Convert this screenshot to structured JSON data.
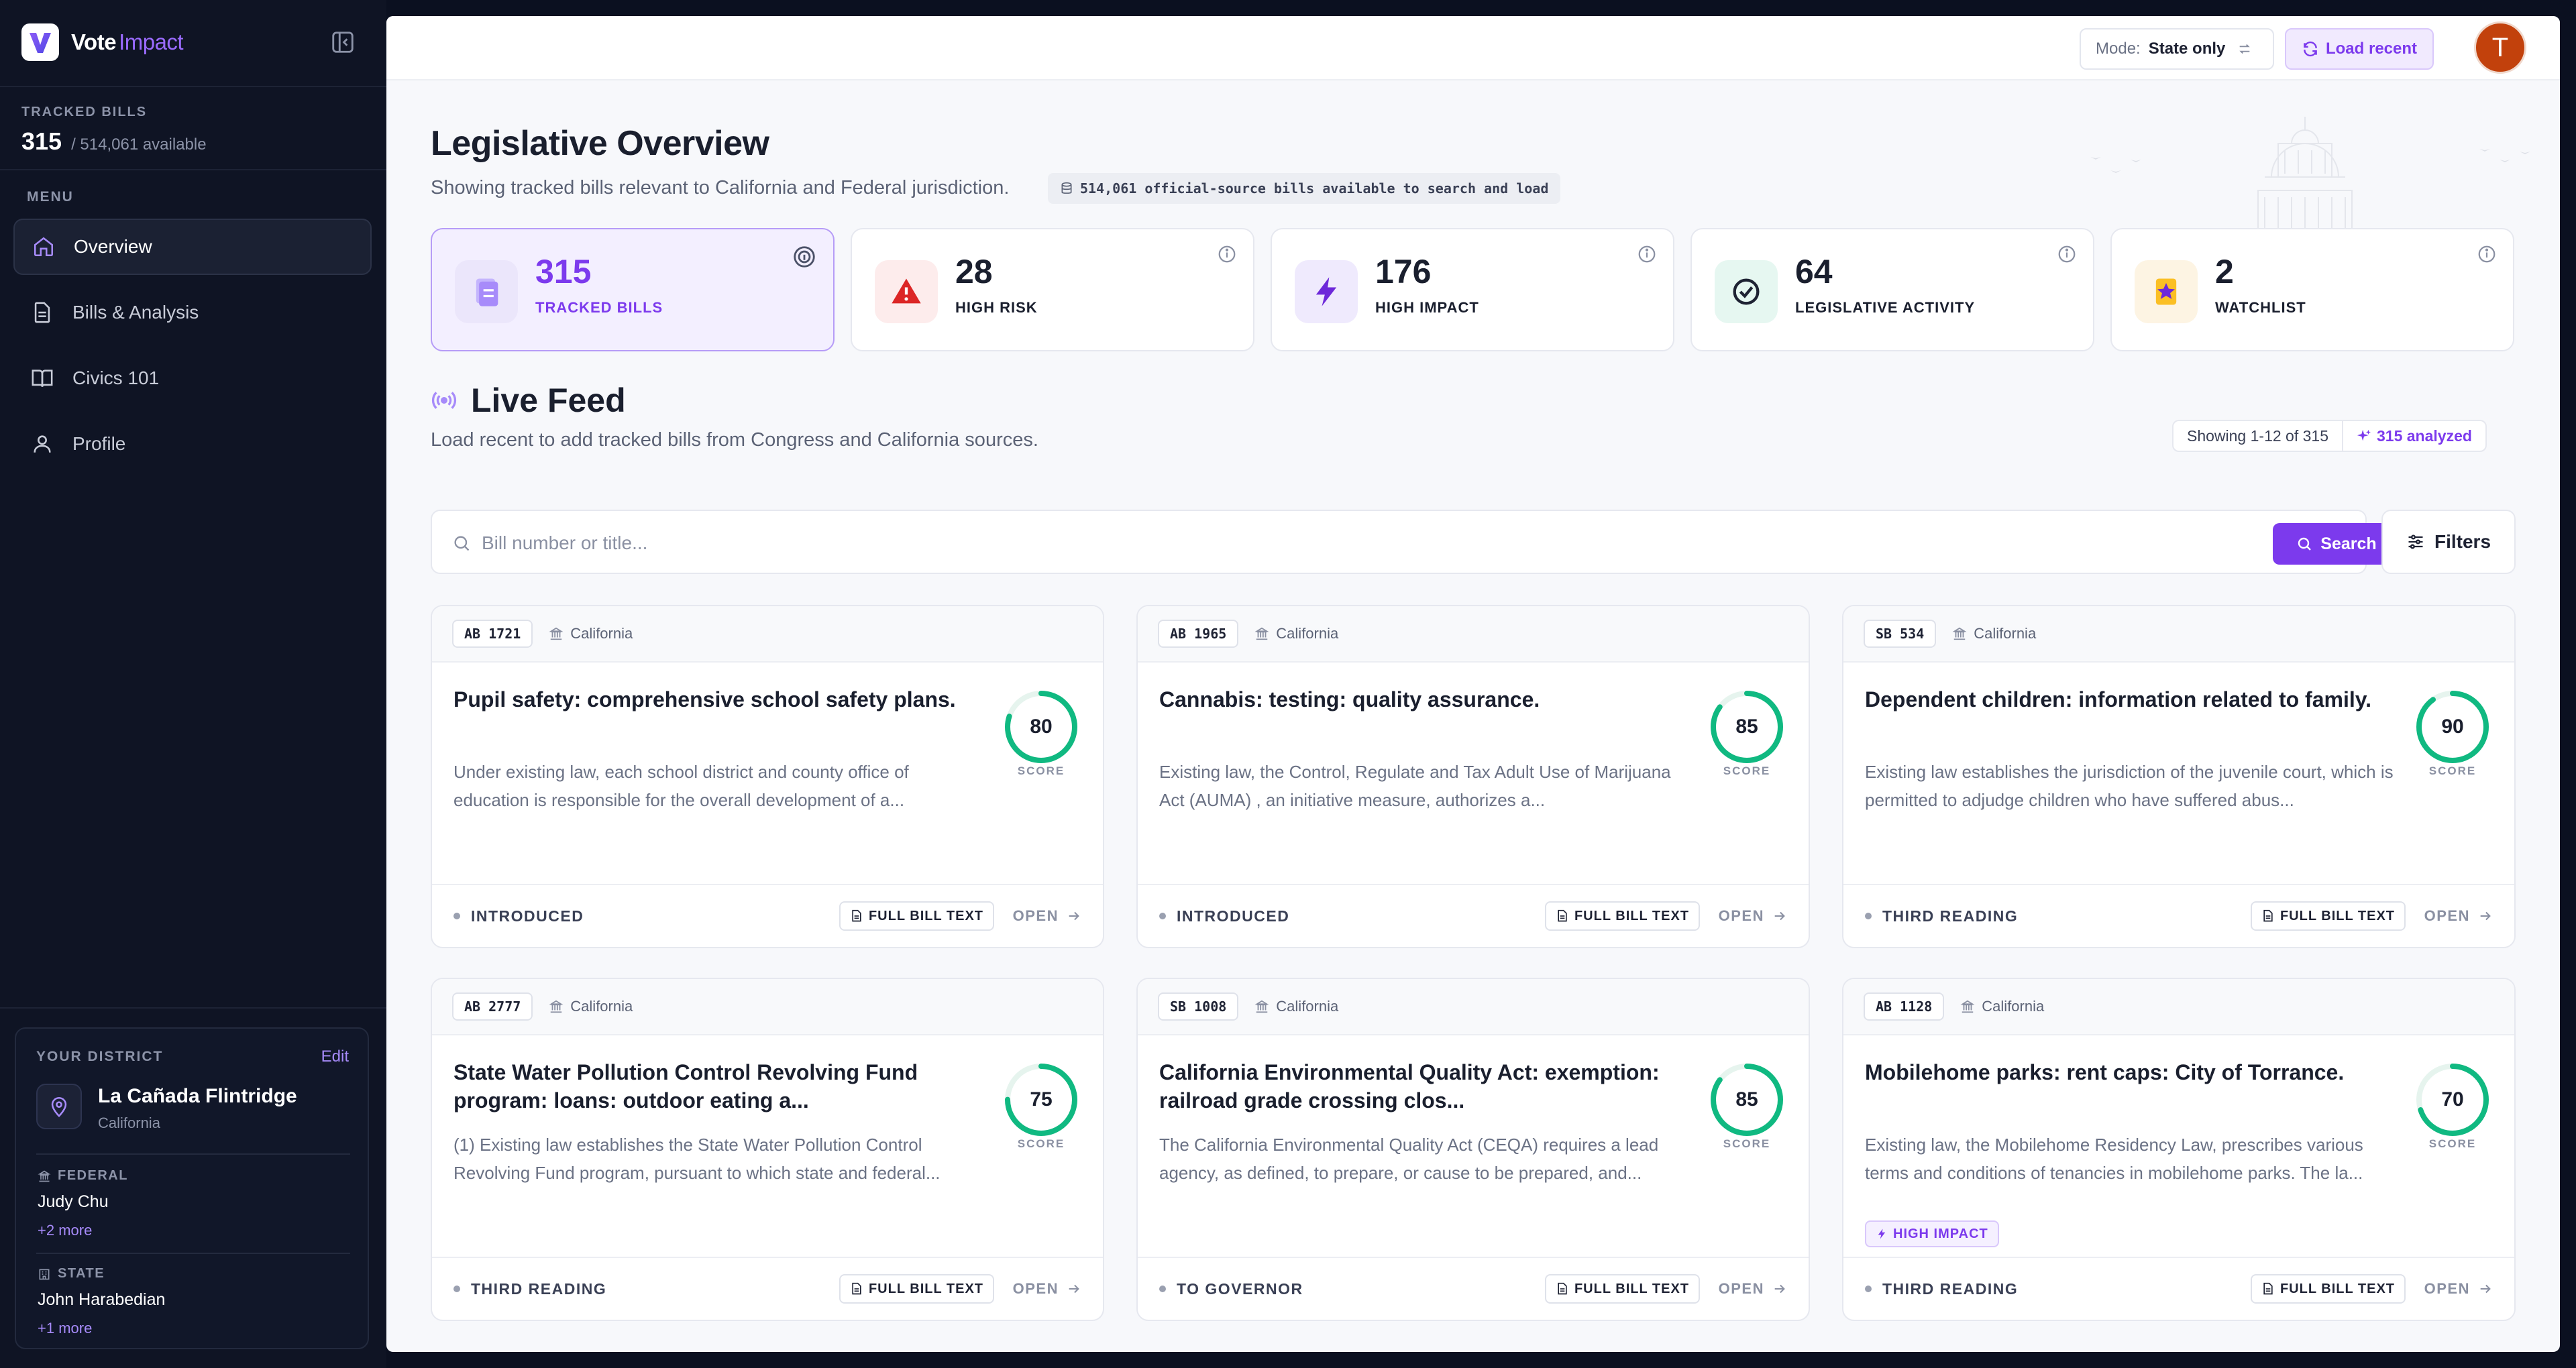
{
  "brand": {
    "name_a": "Vote",
    "name_b": "Impact"
  },
  "sidebar": {
    "tracked_label": "TRACKED BILLS",
    "tracked_count": "315",
    "tracked_available": "/ 514,061 available",
    "menu_label": "MENU",
    "items": [
      {
        "label": "Overview",
        "icon": "home-icon",
        "active": true
      },
      {
        "label": "Bills & Analysis",
        "icon": "document-icon"
      },
      {
        "label": "Civics 101",
        "icon": "book-icon"
      },
      {
        "label": "Profile",
        "icon": "user-icon"
      }
    ],
    "district": {
      "label": "YOUR DISTRICT",
      "edit": "Edit",
      "city": "La Cañada Flintridge",
      "state": "California",
      "federal_label": "FEDERAL",
      "federal_rep": "Judy Chu",
      "federal_more": "+2 more",
      "state_label": "STATE",
      "state_rep": "John Harabedian",
      "state_more": "+1 more"
    }
  },
  "topbar": {
    "mode_key": "Mode:",
    "mode_value": "State only",
    "load_recent": "Load recent",
    "avatar_initial": "T"
  },
  "overview": {
    "title": "Legislative Overview",
    "subtitle": "Showing tracked bills relevant to California and Federal jurisdiction.",
    "available_chip": "514,061 official-source bills available to search and load",
    "stats": [
      {
        "value": "315",
        "label": "TRACKED BILLS"
      },
      {
        "value": "28",
        "label": "HIGH RISK"
      },
      {
        "value": "176",
        "label": "HIGH IMPACT"
      },
      {
        "value": "64",
        "label": "LEGISLATIVE ACTIVITY"
      },
      {
        "value": "2",
        "label": "WATCHLIST"
      }
    ]
  },
  "feed": {
    "title": "Live Feed",
    "subtitle": "Load recent to add tracked bills from Congress and California sources.",
    "showing": "Showing 1-12 of 315",
    "analyzed": "315 analyzed",
    "search_placeholder": "Bill number or title...",
    "search_button": "Search",
    "filters_button": "Filters",
    "full_bill_text": "FULL BILL TEXT",
    "open": "OPEN",
    "score_label": "SCORE",
    "bills": [
      {
        "id": "AB 1721",
        "jurisdiction": "California",
        "title": "Pupil safety: comprehensive school safety plans.",
        "desc": "Under existing law, each school district and county office of education is responsible for the overall development of a...",
        "score": 80,
        "status": "INTRODUCED"
      },
      {
        "id": "AB 1965",
        "jurisdiction": "California",
        "title": "Cannabis: testing: quality assurance.",
        "desc": "Existing law, the Control, Regulate and Tax Adult Use of Marijuana Act (AUMA) , an initiative measure, authorizes a...",
        "score": 85,
        "status": "INTRODUCED"
      },
      {
        "id": "SB 534",
        "jurisdiction": "California",
        "title": "Dependent children: information related to family.",
        "desc": "Existing law establishes the jurisdiction of the juvenile court, which is permitted to adjudge children who have suffered abus...",
        "score": 90,
        "status": "THIRD READING"
      },
      {
        "id": "AB 2777",
        "jurisdiction": "California",
        "title": "State Water Pollution Control Revolving Fund program: loans: outdoor eating a...",
        "desc": "(1) Existing law establishes the State Water Pollution Control Revolving Fund program, pursuant to which state and federal...",
        "score": 75,
        "status": "THIRD READING"
      },
      {
        "id": "SB 1008",
        "jurisdiction": "California",
        "title": "California Environmental Quality Act: exemption: railroad grade crossing clos...",
        "desc": "The California Environmental Quality Act (CEQA) requires a lead agency, as defined, to prepare, or cause to be prepared, and...",
        "score": 85,
        "status": "TO GOVERNOR"
      },
      {
        "id": "AB 1128",
        "jurisdiction": "California",
        "title": "Mobilehome parks: rent caps: City of Torrance.",
        "desc": "Existing law, the Mobilehome Residency Law, prescribes various terms and conditions of tenancies in mobilehome parks. The la...",
        "score": 70,
        "status": "THIRD READING",
        "tag": "HIGH IMPACT"
      }
    ]
  },
  "colors": {
    "accent": "#7c3aed",
    "score_ring": "#10b981",
    "sidebar_bg": "#0f1424"
  }
}
